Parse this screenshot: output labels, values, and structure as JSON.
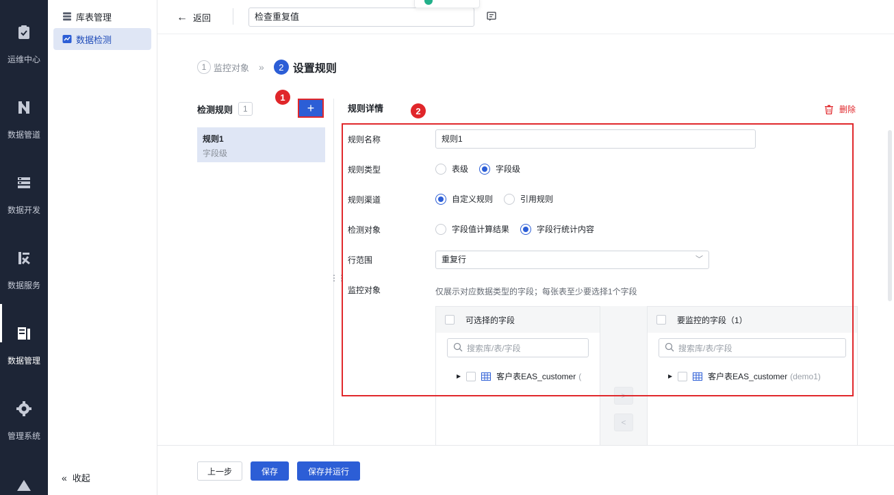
{
  "nav": [
    {
      "label": "运维中心",
      "icon": "clipboard-check-icon"
    },
    {
      "label": "数据管道",
      "icon": "pipeline-icon"
    },
    {
      "label": "数据开发",
      "icon": "server-stack-icon"
    },
    {
      "label": "数据服务",
      "icon": "service-icon"
    },
    {
      "label": "数据管理",
      "icon": "data-management-icon",
      "active": true
    },
    {
      "label": "管理系统",
      "icon": "gear-icon"
    }
  ],
  "subnav": {
    "items": [
      {
        "label": "库表管理",
        "icon": "database-icon"
      },
      {
        "label": "数据检测",
        "icon": "monitor-chart-icon",
        "active": true
      }
    ],
    "collapse_label": "收起"
  },
  "topbar": {
    "back_label": "返回",
    "title_value": "检查重复值"
  },
  "steps": [
    {
      "num": "1",
      "label": "监控对象"
    },
    {
      "num": "2",
      "label": "设置规则"
    }
  ],
  "rules": {
    "heading": "检测规则",
    "count": "1",
    "add_label": "+",
    "items": [
      {
        "name": "规则1",
        "type": "字段级"
      }
    ]
  },
  "markers": [
    "1",
    "2"
  ],
  "detail": {
    "title": "规则详情",
    "delete_label": "删除",
    "fields": {
      "name_label": "规则名称",
      "name_value": "规则1",
      "type_label": "规则类型",
      "type_options": [
        "表级",
        "字段级"
      ],
      "type_selected": "字段级",
      "channel_label": "规则渠道",
      "channel_options": [
        "自定义规则",
        "引用规则"
      ],
      "channel_selected": "自定义规则",
      "target_label": "检测对象",
      "target_options": [
        "字段值计算结果",
        "字段行统计内容"
      ],
      "target_selected": "字段行统计内容",
      "range_label": "行范围",
      "range_value": "重复行",
      "monitor_label": "监控对象",
      "monitor_hint": "仅展示对应数据类型的字段；每张表至少要选择1个字段"
    },
    "transfer": {
      "left_title": "可选择的字段",
      "right_title": "要监控的字段（1）",
      "search_placeholder": "搜索库/表/字段",
      "left_item": "客户表EAS_customer",
      "left_item_suffix": "(",
      "right_item": "客户表EAS_customer",
      "right_item_suffix": "(demo1)",
      "to_right": ">",
      "to_left": "<"
    }
  },
  "footer": {
    "prev_label": "上一步",
    "save_label": "保存",
    "save_run_label": "保存并运行"
  },
  "colors": {
    "primary": "#2c5ed6",
    "annotation_red": "#e0262a",
    "nav_bg": "#1d2536"
  }
}
